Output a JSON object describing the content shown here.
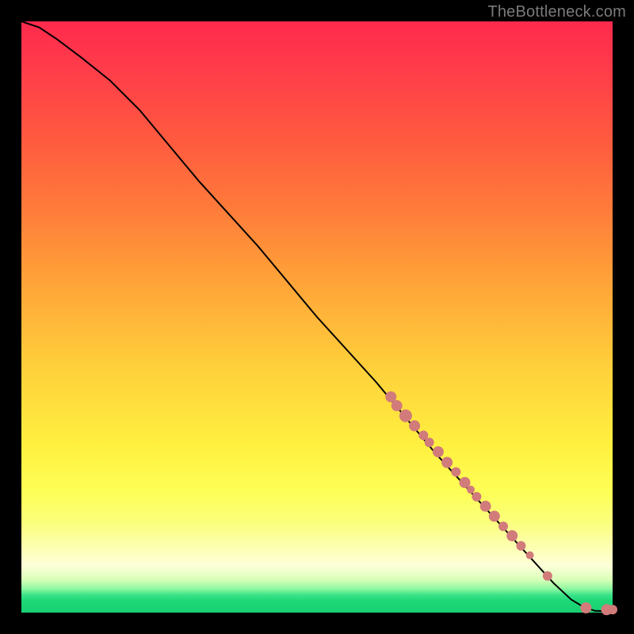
{
  "watermark": "TheBottleneck.com",
  "colors": {
    "point": "#d17b7b",
    "line": "#000000",
    "background_outer": "#000000"
  },
  "chart_data": {
    "type": "line",
    "title": "",
    "xlabel": "",
    "ylabel": "",
    "xlim": [
      0,
      100
    ],
    "ylim": [
      0,
      100
    ],
    "grid": false,
    "legend": false,
    "series": [
      {
        "name": "curve",
        "x": [
          0,
          3,
          6,
          10,
          15,
          20,
          30,
          40,
          50,
          60,
          70,
          80,
          85,
          90,
          93,
          95,
          97,
          100
        ],
        "y": [
          100,
          99,
          97,
          94,
          90,
          85,
          73,
          62,
          50,
          39,
          27,
          16,
          10.5,
          5,
          2.2,
          1.0,
          0.3,
          0.2
        ]
      }
    ],
    "points": [
      {
        "x": 62.5,
        "y": 36.5,
        "r": 7
      },
      {
        "x": 63.5,
        "y": 35.0,
        "r": 7
      },
      {
        "x": 65.0,
        "y": 33.3,
        "r": 8
      },
      {
        "x": 66.5,
        "y": 31.6,
        "r": 7
      },
      {
        "x": 68.0,
        "y": 30.0,
        "r": 6
      },
      {
        "x": 69.0,
        "y": 28.8,
        "r": 6
      },
      {
        "x": 70.5,
        "y": 27.2,
        "r": 7
      },
      {
        "x": 72.0,
        "y": 25.4,
        "r": 7
      },
      {
        "x": 73.5,
        "y": 23.8,
        "r": 6
      },
      {
        "x": 75.0,
        "y": 22.0,
        "r": 7
      },
      {
        "x": 76.0,
        "y": 20.8,
        "r": 5
      },
      {
        "x": 77.0,
        "y": 19.6,
        "r": 6
      },
      {
        "x": 78.5,
        "y": 18.0,
        "r": 7
      },
      {
        "x": 80.0,
        "y": 16.3,
        "r": 7
      },
      {
        "x": 81.5,
        "y": 14.6,
        "r": 6
      },
      {
        "x": 83.0,
        "y": 13.0,
        "r": 7
      },
      {
        "x": 84.5,
        "y": 11.3,
        "r": 6
      },
      {
        "x": 86.0,
        "y": 9.7,
        "r": 5
      },
      {
        "x": 89.0,
        "y": 6.2,
        "r": 6
      },
      {
        "x": 95.5,
        "y": 0.8,
        "r": 7
      },
      {
        "x": 99.0,
        "y": 0.5,
        "r": 7
      },
      {
        "x": 100.0,
        "y": 0.5,
        "r": 6
      }
    ]
  }
}
